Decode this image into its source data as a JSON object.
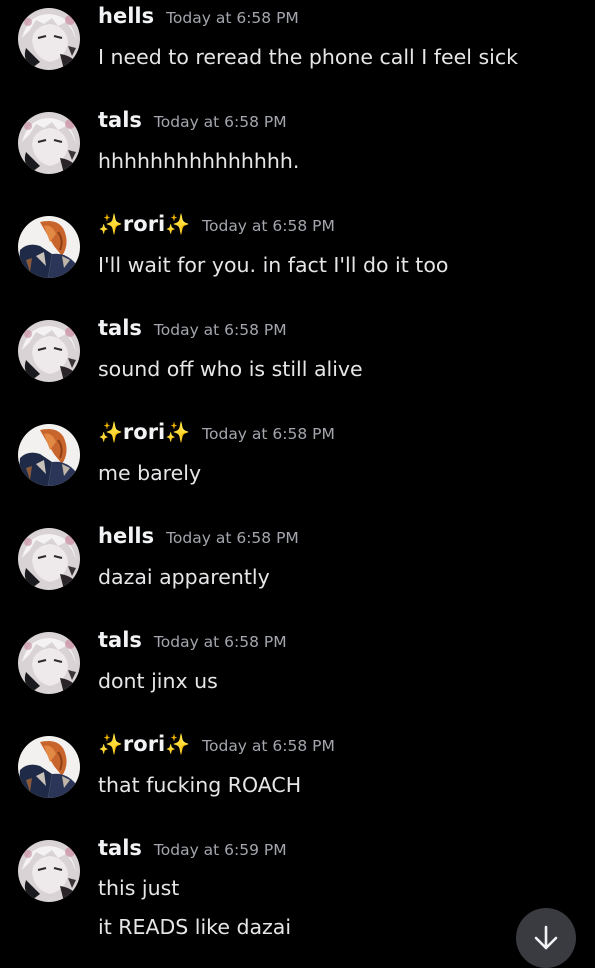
{
  "colors": {
    "background": "#000000",
    "username": "#f2f3f5",
    "timestamp": "#a3a6ad",
    "message_text": "#e6e6e8",
    "sparkle": "#ffd23e",
    "scroll_button": "#3a3b40"
  },
  "messages": [
    {
      "author": "hells",
      "timestamp": "Today at 6:58 PM",
      "lines": [
        "I need to reread the phone call I feel sick"
      ],
      "avatar": "avatar-anime-white-hair"
    },
    {
      "author": "tals",
      "timestamp": "Today at 6:58 PM",
      "lines": [
        "hhhhhhhhhhhhhhh."
      ],
      "avatar": "avatar-anime-white-hair"
    },
    {
      "author": "rori",
      "author_prefix": "✨",
      "author_suffix": "✨",
      "timestamp": "Today at 6:58 PM",
      "lines": [
        "I'll wait for you. in fact I'll do it too"
      ],
      "avatar": "avatar-anime-orange-hair"
    },
    {
      "author": "tals",
      "timestamp": "Today at 6:58 PM",
      "lines": [
        "sound off who is still alive"
      ],
      "avatar": "avatar-anime-white-hair"
    },
    {
      "author": "rori",
      "author_prefix": "✨",
      "author_suffix": "✨",
      "timestamp": "Today at 6:58 PM",
      "lines": [
        "me barely"
      ],
      "avatar": "avatar-anime-orange-hair"
    },
    {
      "author": "hells",
      "timestamp": "Today at 6:58 PM",
      "lines": [
        "dazai apparently"
      ],
      "avatar": "avatar-anime-white-hair"
    },
    {
      "author": "tals",
      "timestamp": "Today at 6:58 PM",
      "lines": [
        "dont jinx us"
      ],
      "avatar": "avatar-anime-white-hair"
    },
    {
      "author": "rori",
      "author_prefix": "✨",
      "author_suffix": "✨",
      "timestamp": "Today at 6:58 PM",
      "lines": [
        "that fucking ROACH"
      ],
      "avatar": "avatar-anime-orange-hair"
    },
    {
      "author": "tals",
      "timestamp": "Today at 6:59 PM",
      "lines": [
        "this just",
        "it READS like dazai"
      ],
      "avatar": "avatar-anime-white-hair"
    }
  ],
  "scroll_button": {
    "icon": "arrow-down-icon"
  }
}
